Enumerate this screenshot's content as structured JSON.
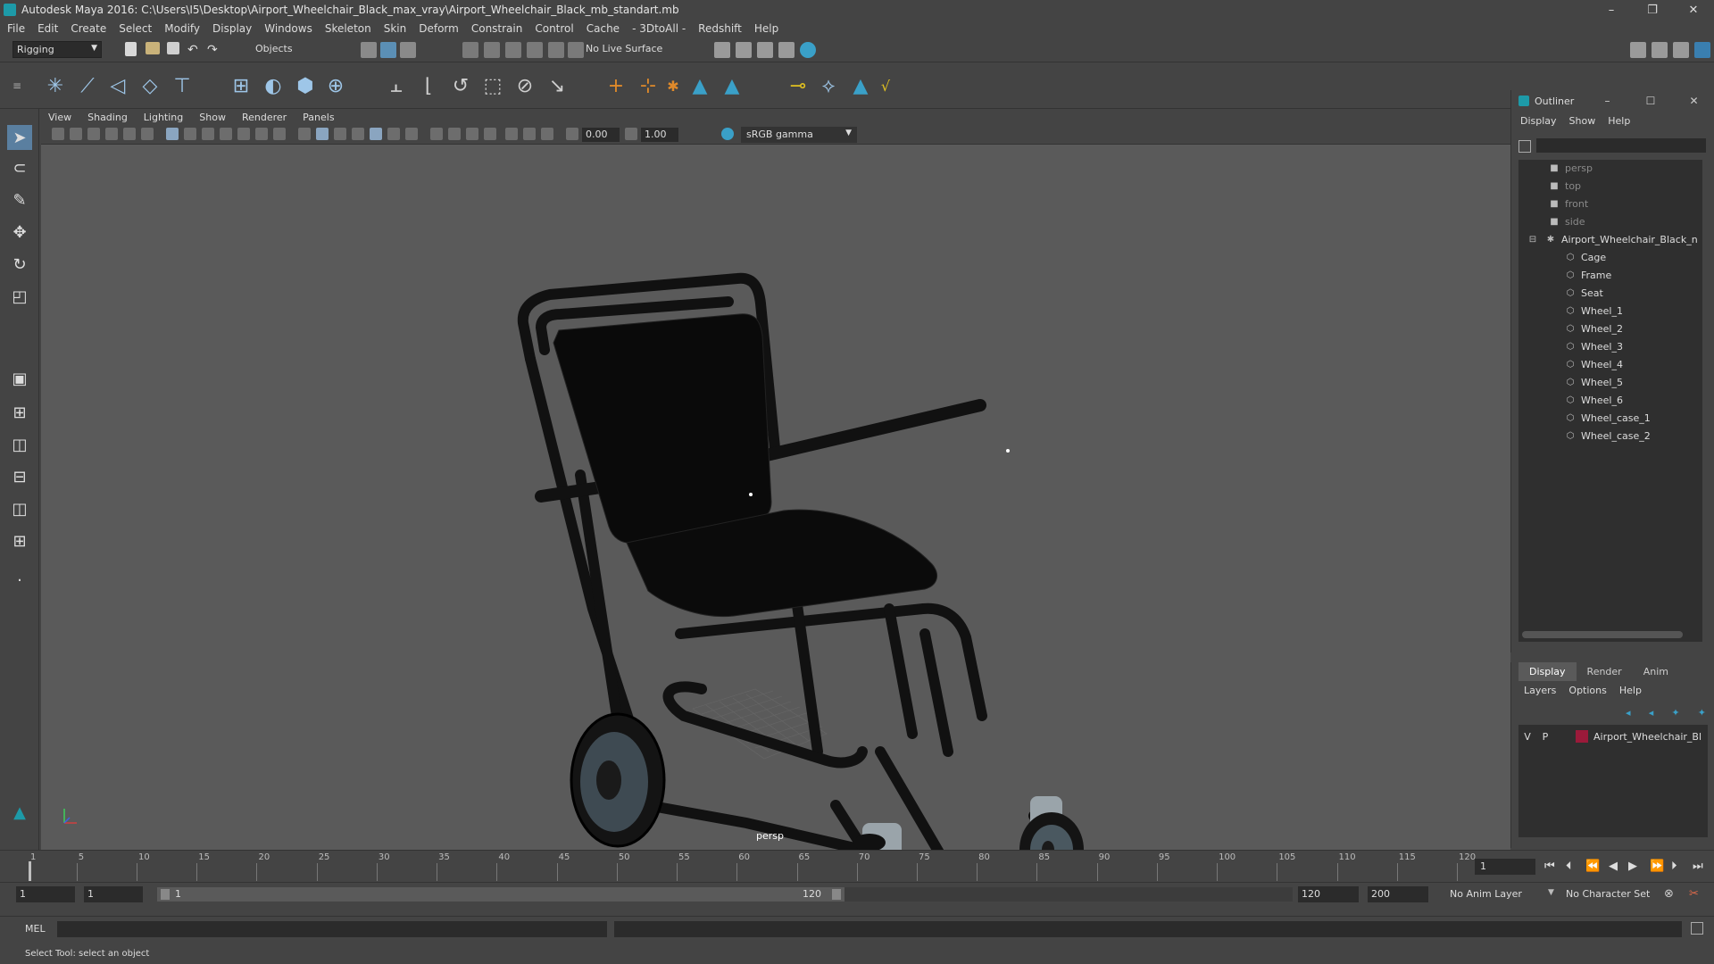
{
  "window": {
    "title": "Autodesk Maya 2016: C:\\Users\\I5\\Desktop\\Airport_Wheelchair_Black_max_vray\\Airport_Wheelchair_Black_mb_standart.mb",
    "controls": [
      "–",
      "❐",
      "✕"
    ]
  },
  "menubar": [
    "File",
    "Edit",
    "Create",
    "Select",
    "Modify",
    "Display",
    "Windows",
    "Skeleton",
    "Skin",
    "Deform",
    "Constrain",
    "Control",
    "Cache",
    "- 3DtoAll -",
    "Redshift",
    "Help"
  ],
  "statusline": {
    "mode": "Rigging",
    "selection_mode": "Objects",
    "live_surface": "No Live Surface"
  },
  "viewport": {
    "menu": [
      "View",
      "Shading",
      "Lighting",
      "Show",
      "Renderer",
      "Panels"
    ],
    "exposure": "0.00",
    "gamma": "1.00",
    "color_space": "sRGB gamma",
    "camera_label": "persp"
  },
  "outliner": {
    "title": "Outliner",
    "menu": [
      "Display",
      "Show",
      "Help"
    ],
    "items": [
      {
        "label": "persp",
        "icon": "camera-icon",
        "style": "dim"
      },
      {
        "label": "top",
        "icon": "camera-icon",
        "style": "dim"
      },
      {
        "label": "front",
        "icon": "camera-icon",
        "style": "dim"
      },
      {
        "label": "side",
        "icon": "camera-icon",
        "style": "dim"
      },
      {
        "label": "Airport_Wheelchair_Black_n",
        "icon": "group-icon",
        "style": "light"
      },
      {
        "label": "Cage",
        "icon": "mesh-icon",
        "style": "light"
      },
      {
        "label": "Frame",
        "icon": "mesh-icon",
        "style": "light"
      },
      {
        "label": "Seat",
        "icon": "mesh-icon",
        "style": "light"
      },
      {
        "label": "Wheel_1",
        "icon": "mesh-icon",
        "style": "light"
      },
      {
        "label": "Wheel_2",
        "icon": "mesh-icon",
        "style": "light"
      },
      {
        "label": "Wheel_3",
        "icon": "mesh-icon",
        "style": "light"
      },
      {
        "label": "Wheel_4",
        "icon": "mesh-icon",
        "style": "light"
      },
      {
        "label": "Wheel_5",
        "icon": "mesh-icon",
        "style": "light"
      },
      {
        "label": "Wheel_6",
        "icon": "mesh-icon",
        "style": "light"
      },
      {
        "label": "Wheel_case_1",
        "icon": "mesh-icon",
        "style": "light"
      },
      {
        "label": "Wheel_case_2",
        "icon": "mesh-icon",
        "style": "light"
      }
    ]
  },
  "layers": {
    "tabs": [
      "Display",
      "Render",
      "Anim"
    ],
    "active_tab": "Display",
    "menu": [
      "Layers",
      "Options",
      "Help"
    ],
    "rows": [
      {
        "visible": "V",
        "playback": "P",
        "name": "Airport_Wheelchair_Bl",
        "color": "#9b1a3a"
      }
    ]
  },
  "timeline": {
    "ticks": [
      1,
      5,
      10,
      15,
      20,
      25,
      30,
      35,
      40,
      45,
      50,
      55,
      60,
      65,
      70,
      75,
      80,
      85,
      90,
      95,
      100,
      105,
      110,
      115,
      120
    ],
    "current_frame": "1"
  },
  "range": {
    "start": "1",
    "playback_start": "1",
    "slider_start": "1",
    "slider_end": "120",
    "playback_end": "120",
    "end": "200",
    "anim_layer": "No Anim Layer",
    "character_set": "No Character Set"
  },
  "command": {
    "language": "MEL",
    "help_text": "Select Tool: select an object"
  },
  "colors": {
    "ui_bg": "#444444",
    "viewport_bg": "#5a5a5a",
    "maya_accent": "#1d9aa8",
    "layer_color": "#9b1a3a"
  }
}
